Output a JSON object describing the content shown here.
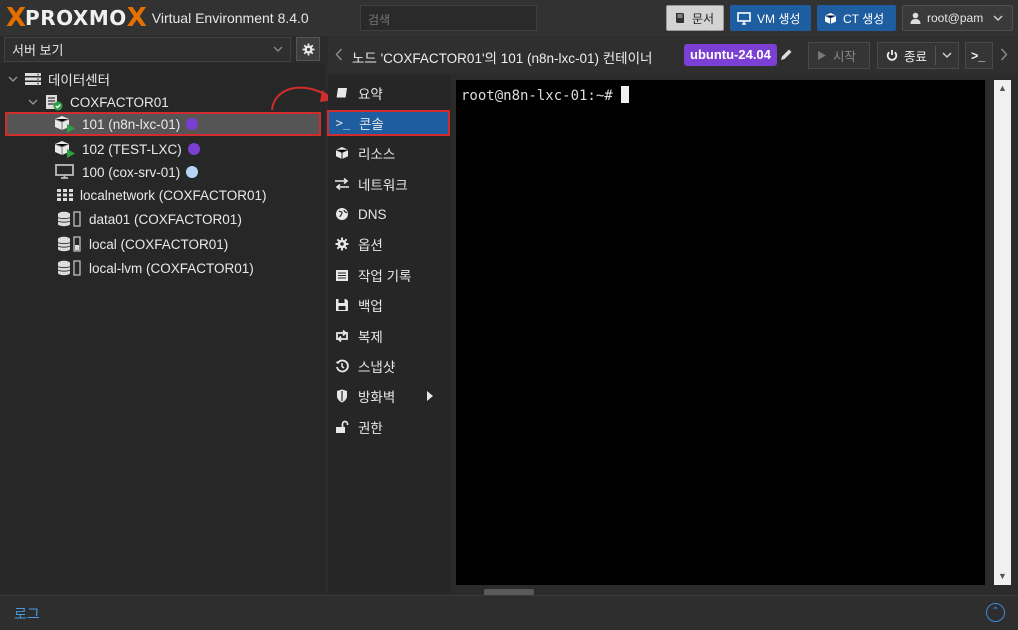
{
  "header": {
    "logo_x": "X",
    "logo_text": "PROXMO",
    "logo_x2": "X",
    "version": "Virtual Environment 8.4.0",
    "search_placeholder": "검색",
    "doc_label": "문서",
    "vm_label": "VM 생성",
    "ct_label": "CT 생성",
    "user_label": "root@pam"
  },
  "sidebar": {
    "view_label": "서버 보기",
    "tree": [
      {
        "label": "데이터센터",
        "icon": "datacenter-icon"
      },
      {
        "label": "COXFACTOR01",
        "icon": "node-icon"
      },
      {
        "label": "101 (n8n-lxc-01)",
        "icon": "container-running-icon",
        "status_color": "#7b3fd3"
      },
      {
        "label": "102 (TEST-LXC)",
        "icon": "container-running-icon",
        "status_color": "#7b3fd3"
      },
      {
        "label": "100 (cox-srv-01)",
        "icon": "vm-icon",
        "status_color": "#b8d4f5"
      },
      {
        "label": "localnetwork (COXFACTOR01)",
        "icon": "network-icon"
      },
      {
        "label": "data01 (COXFACTOR01)",
        "icon": "storage-icon"
      },
      {
        "label": "local (COXFACTOR01)",
        "icon": "storage-icon"
      },
      {
        "label": "local-lvm (COXFACTOR01)",
        "icon": "storage-icon"
      }
    ]
  },
  "content": {
    "title": "노드 'COXFACTOR01'의 101 (n8n-lxc-01) 컨테이너",
    "tag": "ubuntu-24.04",
    "start_label": "시작",
    "shutdown_label": "종료",
    "console_label": ">_"
  },
  "nav": [
    {
      "label": "요약",
      "icon": "book-icon"
    },
    {
      "label": "콘솔",
      "icon": "terminal-icon",
      "active": true
    },
    {
      "label": "리소스",
      "icon": "cube-icon"
    },
    {
      "label": "네트워크",
      "icon": "exchange-icon"
    },
    {
      "label": "DNS",
      "icon": "globe-icon"
    },
    {
      "label": "옵션",
      "icon": "gear-icon"
    },
    {
      "label": "작업 기록",
      "icon": "list-icon"
    },
    {
      "label": "백업",
      "icon": "floppy-icon"
    },
    {
      "label": "복제",
      "icon": "retweet-icon"
    },
    {
      "label": "스냅샷",
      "icon": "history-icon"
    },
    {
      "label": "방화벽",
      "icon": "shield-icon"
    },
    {
      "label": "권한",
      "icon": "unlock-icon"
    }
  ],
  "terminal": {
    "prompt": "root@n8n-lxc-01:~#"
  },
  "log": {
    "label": "로그"
  },
  "colors": {
    "brand_orange": "#e57000",
    "accent_blue": "#1d5da0",
    "highlight_red": "#d12d2d",
    "tag_purple": "#7b3fd3"
  }
}
